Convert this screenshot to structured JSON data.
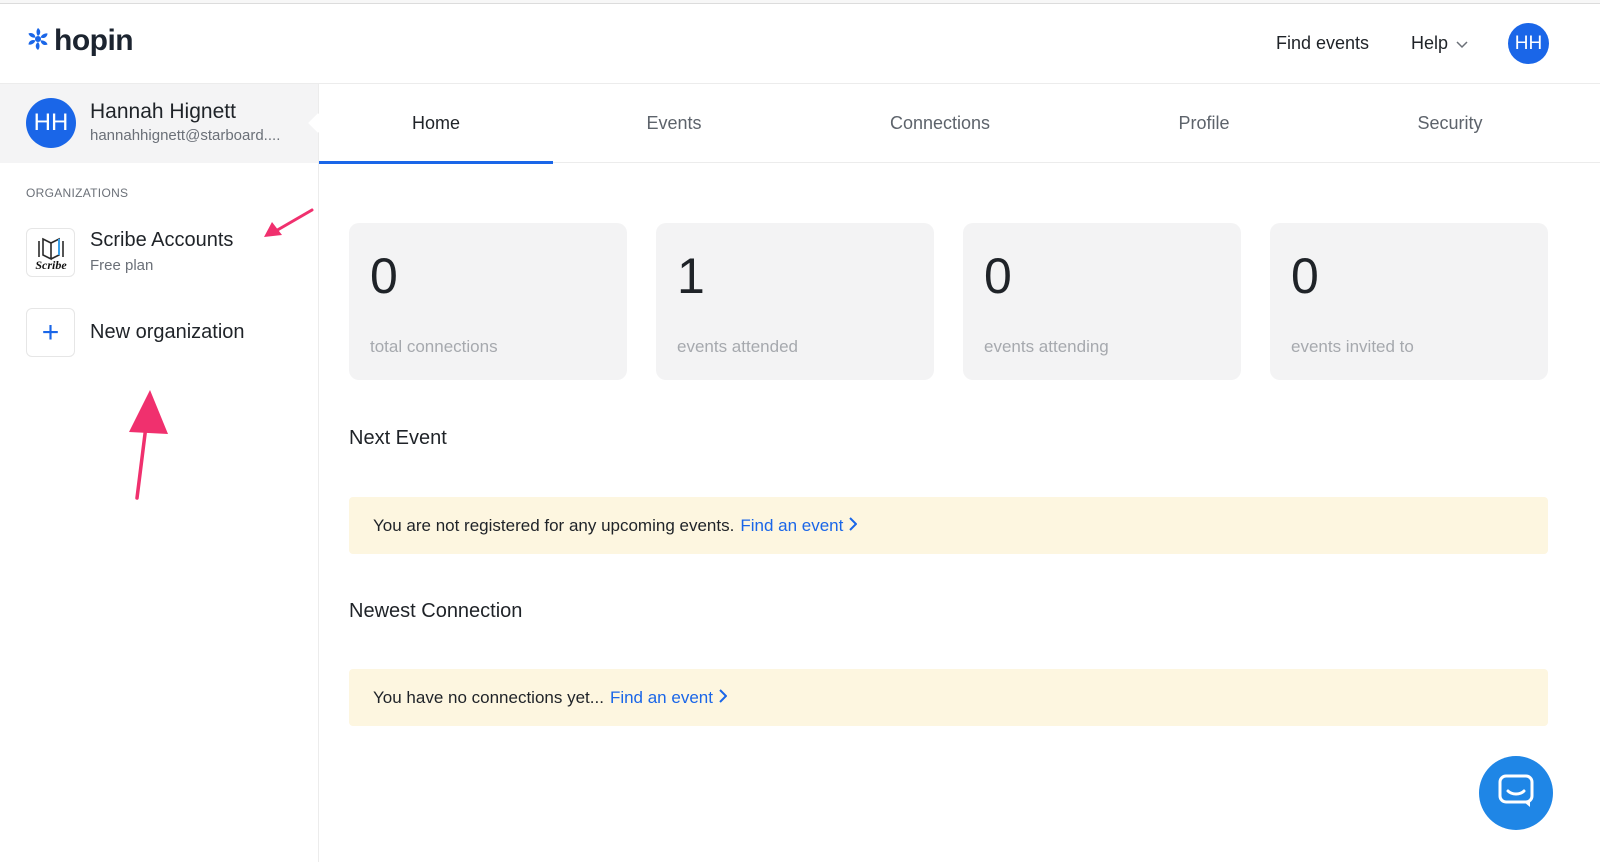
{
  "header": {
    "logo_text": "hopin",
    "find_events": "Find events",
    "help": "Help",
    "avatar_initials": "HH"
  },
  "user": {
    "initials": "HH",
    "name": "Hannah Hignett",
    "email": "hannahhignett@starboard...."
  },
  "sidebar": {
    "org_heading": "ORGANIZATIONS",
    "org": {
      "name": "Scribe Accounts",
      "plan": "Free plan",
      "logo_text": "Scribe"
    },
    "new_org_label": "New organization",
    "new_org_icon": "+"
  },
  "tabs": [
    {
      "label": "Home"
    },
    {
      "label": "Events"
    },
    {
      "label": "Connections"
    },
    {
      "label": "Profile"
    },
    {
      "label": "Security"
    }
  ],
  "stats": [
    {
      "value": "0",
      "label": "total connections"
    },
    {
      "value": "1",
      "label": "events attended"
    },
    {
      "value": "0",
      "label": "events attending"
    },
    {
      "value": "0",
      "label": "events invited to"
    }
  ],
  "next_event": {
    "title": "Next Event",
    "message": "You are not registered for any upcoming events.",
    "link": "Find an event"
  },
  "newest_connection": {
    "title": "Newest Connection",
    "message": "You have no connections yet...",
    "link": "Find an event"
  },
  "colors": {
    "accent": "#1a66e8",
    "annotation": "#f0306e",
    "notice_bg": "#fdf6e0",
    "chat": "#1f86e6"
  },
  "icons": [
    "hopin-logo-icon",
    "chevron-down-icon",
    "plus-icon",
    "chevron-right-icon",
    "chat-icon",
    "annotation-arrow-icon"
  ]
}
